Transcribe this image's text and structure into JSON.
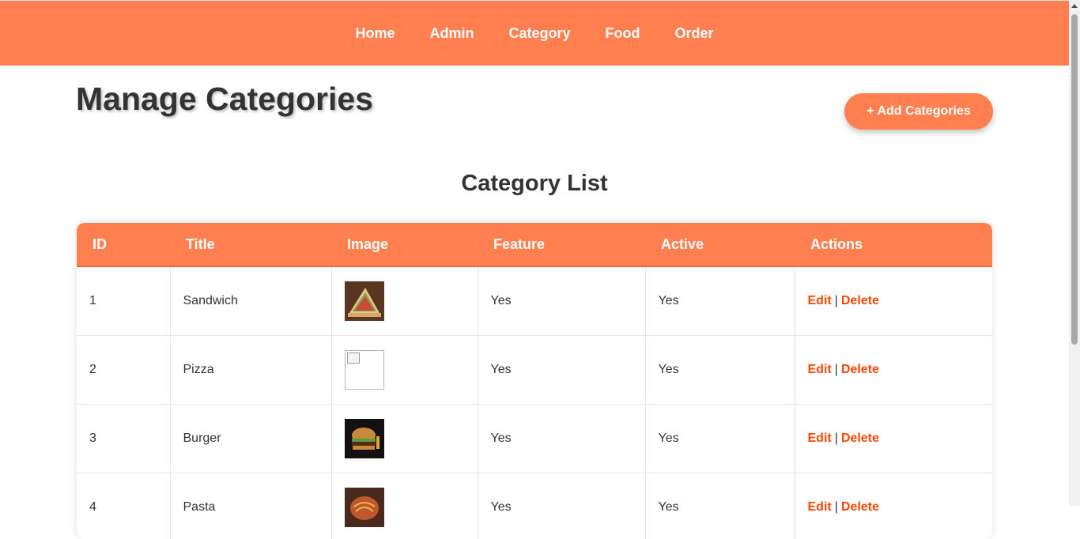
{
  "nav": {
    "items": [
      {
        "label": "Home"
      },
      {
        "label": "Admin"
      },
      {
        "label": "Category"
      },
      {
        "label": "Food"
      },
      {
        "label": "Order"
      }
    ]
  },
  "page": {
    "title": "Manage Categories",
    "add_button": "+ Add Categories",
    "list_title": "Category List"
  },
  "table": {
    "headers": [
      "ID",
      "Title",
      "Image",
      "Feature",
      "Active",
      "Actions"
    ],
    "rows": [
      {
        "id": "1",
        "title": "Sandwich",
        "image": "sandwich-photo",
        "feature": "Yes",
        "active": "Yes",
        "edit": "Edit",
        "separator": "|",
        "delete": "Delete"
      },
      {
        "id": "2",
        "title": "Pizza",
        "image": "broken-image-icon",
        "feature": "Yes",
        "active": "Yes",
        "edit": "Edit",
        "separator": "|",
        "delete": "Delete"
      },
      {
        "id": "3",
        "title": "Burger",
        "image": "burger-photo",
        "feature": "Yes",
        "active": "Yes",
        "edit": "Edit",
        "separator": "|",
        "delete": "Delete"
      },
      {
        "id": "4",
        "title": "Pasta",
        "image": "pasta-photo",
        "feature": "Yes",
        "active": "Yes",
        "edit": "Edit",
        "separator": "|",
        "delete": "Delete"
      }
    ]
  },
  "colors": {
    "accent": "#ff7f50",
    "action_link": "#ff4500",
    "text": "#333333"
  }
}
